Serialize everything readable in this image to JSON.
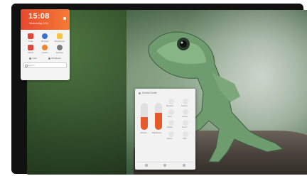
{
  "widget": {
    "time": "15:08",
    "date": "Wednesday 2024",
    "apps": [
      {
        "label": "Tools",
        "color": "#e94335",
        "icon": "tools-icon"
      },
      {
        "label": "Browser",
        "color": "#3b6fd8",
        "icon": "globe-icon"
      },
      {
        "label": "Documents",
        "color": "#f5c542",
        "icon": "folder-icon"
      },
      {
        "label": "Media",
        "color": "#e2453a",
        "icon": "media-icon"
      },
      {
        "label": "Firefox",
        "color": "#f0862e",
        "icon": "firefox-icon"
      },
      {
        "label": "Settings",
        "color": "#7b7b7b",
        "icon": "gear-icon"
      }
    ],
    "buttons": [
      "Lock",
      "Shutdown"
    ],
    "search_placeholder": "Search"
  },
  "control_panel": {
    "title": "Control Center",
    "sliders": [
      {
        "label": "Volume",
        "level": 0.48
      },
      {
        "label": "Brightness",
        "level": 0.62
      }
    ],
    "controls": [
      "Bluetooth",
      "Network",
      "Wi-Fi",
      "Hotspot",
      "Display",
      "Sound",
      "Battery",
      "Night"
    ]
  }
}
